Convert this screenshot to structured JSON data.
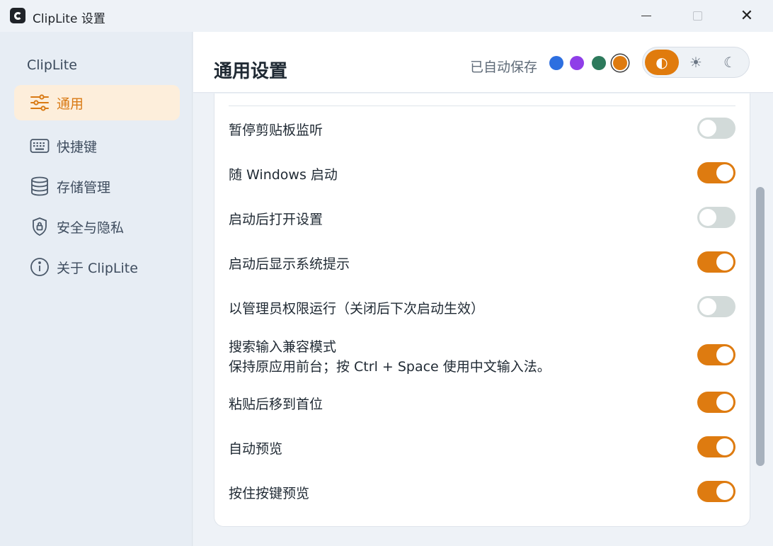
{
  "window": {
    "title": "ClipLite 设置",
    "controls": {
      "minimize": "minimize",
      "maximize": "maximize",
      "close": "✕"
    }
  },
  "sidebar": {
    "brand": "ClipLite",
    "items": [
      {
        "label": "通用",
        "icon": "sliders-icon",
        "active": true
      },
      {
        "label": "快捷键",
        "icon": "keyboard-icon",
        "active": false
      },
      {
        "label": "存储管理",
        "icon": "database-icon",
        "active": false
      },
      {
        "label": "安全与隐私",
        "icon": "shield-lock-icon",
        "active": false
      },
      {
        "label": "关于 ClipLite",
        "icon": "info-icon",
        "active": false
      }
    ]
  },
  "header": {
    "title": "通用设置",
    "save_status": "已自动保存",
    "accent_swatches": [
      {
        "name": "blue",
        "color": "#2d6fe0",
        "selected": false
      },
      {
        "name": "purple",
        "color": "#8f3ee8",
        "selected": false
      },
      {
        "name": "green",
        "color": "#2d7a5c",
        "selected": false
      },
      {
        "name": "orange",
        "color": "#de7b10",
        "selected": true
      }
    ],
    "theme_modes": [
      {
        "name": "auto",
        "glyph": "◐",
        "active": true
      },
      {
        "name": "light",
        "glyph": "☀",
        "active": false
      },
      {
        "name": "dark",
        "glyph": "☾",
        "active": false
      }
    ]
  },
  "settings": [
    {
      "label": "暂停剪贴板监听",
      "on": false
    },
    {
      "label": "随 Windows 启动",
      "on": true
    },
    {
      "label": "启动后打开设置",
      "on": false
    },
    {
      "label": "启动后显示系统提示",
      "on": true
    },
    {
      "label": "以管理员权限运行（关闭后下次启动生效）",
      "on": false
    },
    {
      "label": "搜索输入兼容模式",
      "sub": "保持原应用前台；按 Ctrl + Space 使用中文输入法。",
      "on": true
    },
    {
      "label": "粘贴后移到首位",
      "on": true
    },
    {
      "label": "自动预览",
      "on": true
    },
    {
      "label": "按住按键预览",
      "on": true
    }
  ],
  "colors": {
    "accent": "#de7b10",
    "toggle_off": "#d2dad9",
    "active_nav_bg": "#fdeedb"
  }
}
